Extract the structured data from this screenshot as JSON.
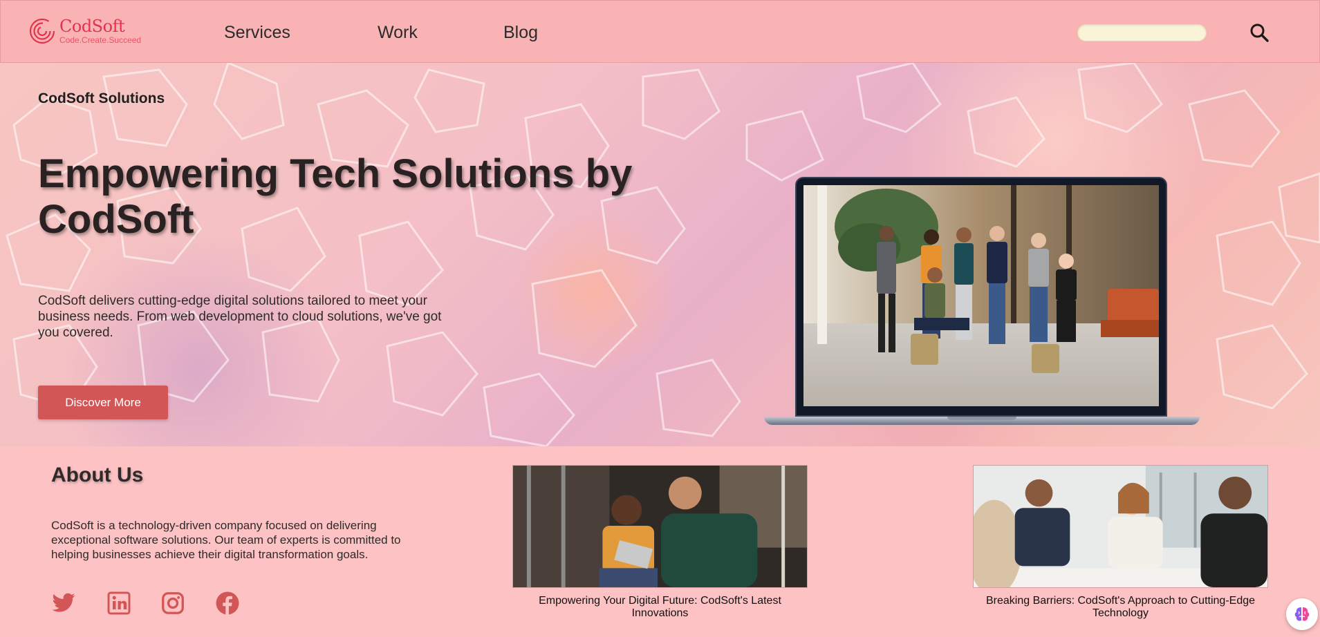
{
  "brand": {
    "name": "CodSoft",
    "tagline": "Code.Create.Succeed",
    "accent": "#e2334d"
  },
  "nav": {
    "items": [
      {
        "label": "Services"
      },
      {
        "label": "Work"
      },
      {
        "label": "Blog"
      }
    ]
  },
  "search": {
    "value": "",
    "icon": "search-icon"
  },
  "hero": {
    "eyebrow": "CodSoft Solutions",
    "title": "Empowering Tech Solutions by CodSoft",
    "description": "CodSoft delivers cutting-edge digital solutions tailored to meet your business needs. From web development to cloud solutions, we've got you covered.",
    "button_label": "Discover More",
    "button_color": "#d35656",
    "image": "team-photo-on-laptop"
  },
  "about": {
    "title": "About Us",
    "text": "CodSoft is a technology-driven company focused on delivering exceptional software solutions. Our team of experts is committed to helping businesses achieve their digital transformation goals.",
    "social": [
      {
        "icon": "twitter-icon"
      },
      {
        "icon": "linkedin-icon"
      },
      {
        "icon": "instagram-icon"
      },
      {
        "icon": "facebook-icon"
      }
    ],
    "social_color": "#d35656"
  },
  "cards": [
    {
      "caption": "Empowering Your Digital Future: CodSoft's Latest Innovations"
    },
    {
      "caption": "Breaking Barriers: CodSoft's Approach to Cutting-Edge Technology"
    }
  ],
  "colors": {
    "header_bg": "#f9b3b5",
    "page_bg": "#fdc2c3",
    "search_bg": "#f8f3d9"
  }
}
